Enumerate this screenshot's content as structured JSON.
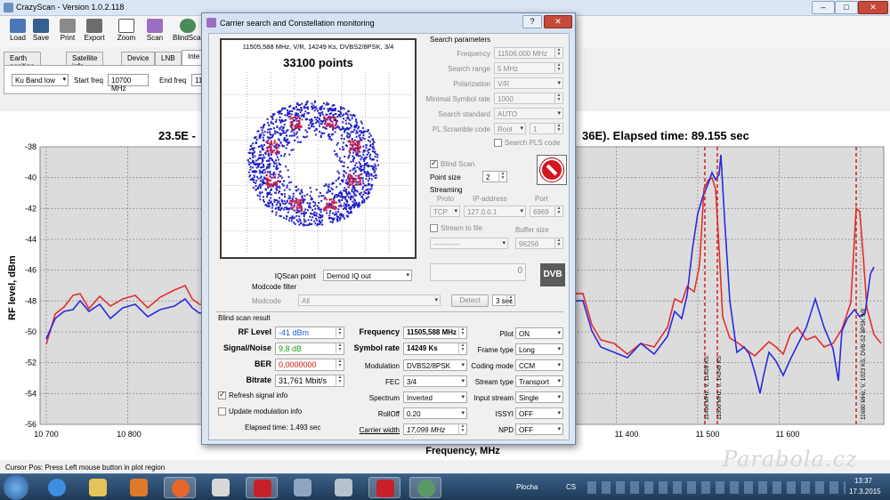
{
  "window": {
    "title": "CrazyScan - Version 1.0.2.118",
    "min": "–",
    "max": "□",
    "close": "✕"
  },
  "toolbar": {
    "load": "Load",
    "save": "Save",
    "print": "Print",
    "export": "Export",
    "zoom": "Zoom",
    "scan": "Scan",
    "blindscan": "BlindScan"
  },
  "tabs": [
    "Earth position",
    "Satellite info",
    "Device",
    "LNB",
    "Inte"
  ],
  "bandbar": {
    "band": "Ku Band low",
    "start_label": "Start freq",
    "start_value": "10700 MHz",
    "end_label": "End freq",
    "end_value": "11"
  },
  "plot": {
    "title_left": "23.5E -",
    "title_right": "36E). Elapsed time: 89.155 sec",
    "ylabel": "RF level, dBm",
    "xlabel": "Frequency, MHz",
    "y_ticks": [
      "-38",
      "-40",
      "-42",
      "-44",
      "-46",
      "-48",
      "-50",
      "-52",
      "-54",
      "-56"
    ],
    "x_ticks": [
      "10 700",
      "10 800",
      "11 400",
      "11 500",
      "11 600"
    ],
    "markers": [
      "11496 MHz, V, 11428 KS",
      "11506 MHz, V, 14249 KS",
      "11680 MHz, V, 1023 KS, DVB-S2 8PSK 9/8"
    ],
    "series_colors": {
      "blue": "#2a2ae0",
      "red": "#e03030"
    }
  },
  "status": {
    "cursor": "Cursor Pos: Press Left mouse button in plot region"
  },
  "watermark": "Parabola.cz",
  "dialog": {
    "title": "Carrier search and Constellation monitoring",
    "help": "?",
    "close": "✕",
    "constellation": {
      "info": "11505,588 MHz, V/R, 14249 Ks, DVBS2/8PSK, 3/4",
      "points": "33100 points"
    },
    "search_params": {
      "header": "Search parameters",
      "frequency_label": "Frequency",
      "frequency_value": "11506,000 MHz",
      "range_label": "Search range",
      "range_value": "5 MHz",
      "polarization_label": "Polarization",
      "polarization_value": "V/R",
      "minsym_label": "Minimal Symbol rate",
      "minsym_value": "1000",
      "standard_label": "Search standard",
      "standard_value": "AUTO",
      "pls_label": "PL Scramble code",
      "pls_mode": "Root",
      "pls_value": "1",
      "search_pls": "Search PLS code",
      "blindscan": "Blind Scan",
      "point_size_label": "Point size",
      "point_size_value": "2"
    },
    "streaming": {
      "header": "Streaming",
      "proto_label": "Proto",
      "ip_label": "IP-address",
      "port_label": "Port",
      "proto_value": "TCP",
      "ip_value": "127.0.0.1",
      "port_value": "6969",
      "stream_file": "Stream to file",
      "buffer_label": "Buffer size",
      "file_value": "-----------",
      "buffer_value": "96256"
    },
    "iq": {
      "label": "IQScan point",
      "value": "Demod IQ out",
      "counter": "0",
      "dvb_logo": "DVB"
    },
    "modcode": {
      "header": "Modcode filter",
      "label": "Modcode",
      "value": "All",
      "detect": "Detect",
      "interval": "3 sec"
    },
    "result": {
      "header": "Blind scan result",
      "rf_label": "RF Level",
      "rf_value": "-41 dBm",
      "sn_label": "Signal/Noise",
      "sn_value": "9,8 dB",
      "ber_label": "BER",
      "ber_value": "0,0000000",
      "bitrate_label": "Bitrate",
      "bitrate_value": "31,761 Mbit/s",
      "refresh": "Refresh signal info",
      "update_mod": "Update modulation info",
      "elapsed": "Elapsed time: 1.493 sec",
      "frequency_label": "Frequency",
      "frequency_value": "11505,588 MHz",
      "symrate_label": "Symbol rate",
      "symrate_value": "14249 Ks",
      "modulation_label": "Modulation",
      "modulation_value": "DVBS2/8PSK",
      "fec_label": "FEC",
      "fec_value": "3/4",
      "spectrum_label": "Spectrum",
      "spectrum_value": "Inverted",
      "rolloff_label": "RollOff",
      "rolloff_value": "0.20",
      "carrier_label": "Carrier width",
      "carrier_value": "17,099 MHz",
      "pilot_label": "Pilot",
      "pilot_value": "ON",
      "frametype_label": "Frame type",
      "frametype_value": "Long",
      "codingmode_label": "Coding mode",
      "codingmode_value": "CCM",
      "streamtype_label": "Stream type",
      "streamtype_value": "Transport",
      "inputstream_label": "Input stream",
      "inputstream_value": "Single",
      "issyi_label": "ISSYI",
      "issyi_value": "OFF",
      "npd_label": "NPD",
      "npd_value": "OFF"
    }
  },
  "taskbar": {
    "desktop": "Plocha",
    "lang": "CS",
    "time": "13:37",
    "date": "17.3.2015"
  }
}
